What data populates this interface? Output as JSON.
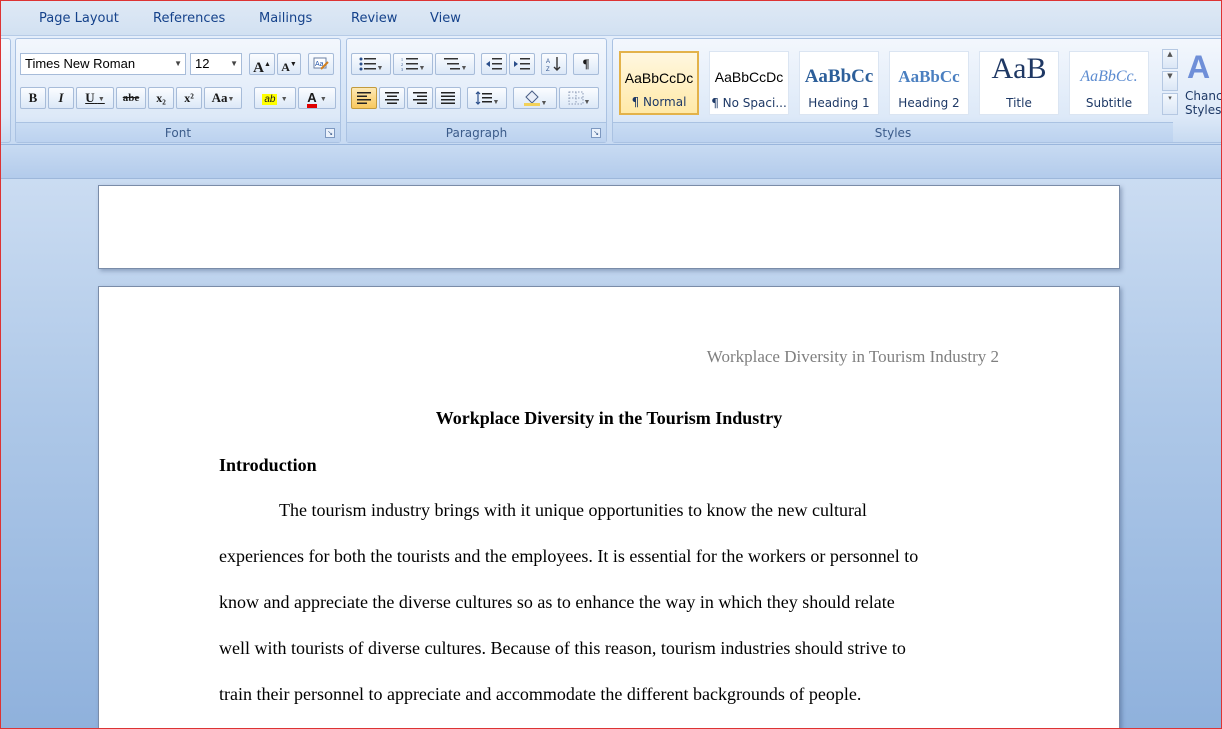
{
  "tabs": [
    "Page Layout",
    "References",
    "Mailings",
    "Review",
    "View"
  ],
  "font_group": {
    "label": "Font",
    "font_name": "Times New Roman",
    "font_size": "12",
    "grow_label": "A",
    "shrink_label": "A",
    "bold": "B",
    "italic": "I",
    "underline": "U",
    "strike": "abe",
    "subscript": "x₂",
    "superscript": "x²",
    "change_case": "Aa",
    "highlight_label": "ab",
    "font_color_label": "A",
    "highlight_color": "#ffff00",
    "font_color": "#e00000"
  },
  "paragraph_group": {
    "label": "Paragraph"
  },
  "styles_group": {
    "label": "Styles",
    "items": [
      {
        "sample": "AaBbCcDc",
        "name": "¶ Normal"
      },
      {
        "sample": "AaBbCcDc",
        "name": "¶ No Spaci..."
      },
      {
        "sample": "AaBbCc",
        "name": "Heading 1"
      },
      {
        "sample": "AaBbCc",
        "name": "Heading 2"
      },
      {
        "sample": "AaB",
        "name": "Title"
      },
      {
        "sample": "AaBbCc.",
        "name": "Subtitle"
      }
    ],
    "change_styles_line1": "Chanc",
    "change_styles_line2": "Styles"
  },
  "document": {
    "header_text": "Workplace Diversity in Tourism  Industry 2",
    "title": "Workplace Diversity in the Tourism Industry",
    "section_heading": "Introduction",
    "paragraph_lines": [
      "The tourism industry brings with it unique opportunities to know the new cultural",
      "experiences for both the tourists and the employees.  It is essential for the workers or personnel to",
      "know and appreciate the diverse cultures so as to enhance the way in which they should relate",
      "well with tourists of diverse cultures. Because of this reason, tourism industries should strive to",
      "train their personnel to appreciate and accommodate the different backgrounds of people."
    ]
  }
}
